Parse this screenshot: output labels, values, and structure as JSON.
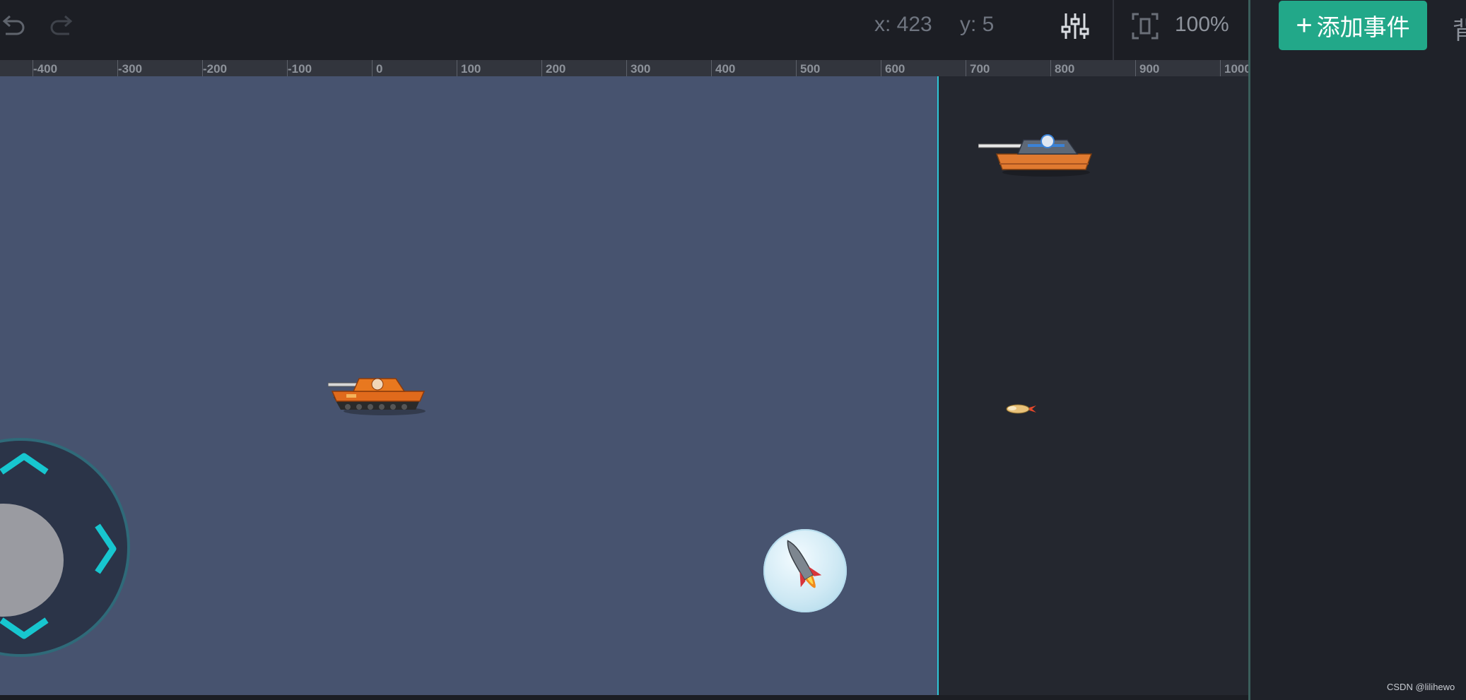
{
  "toolbar": {
    "undo_icon": "undo-icon",
    "redo_icon": "redo-icon",
    "x_label": "x: 423",
    "y_label": "y: 5",
    "settings_icon": "sliders-icon",
    "fit_icon": "fit-screen-icon",
    "zoom": "100%"
  },
  "right_panel": {
    "add_event_plus": "+",
    "add_event_label": "添加事件",
    "cut_text": "背"
  },
  "ruler": {
    "ticks": [
      "-400",
      "-300",
      "-200",
      "-100",
      "0",
      "100",
      "200",
      "300",
      "400",
      "500",
      "600",
      "700",
      "800",
      "900",
      "1000"
    ]
  },
  "colors": {
    "accent": "#22a889",
    "stage": "#47536f",
    "stage_border": "#2ec6d6",
    "joystick_arrow": "#17c6cf"
  },
  "canvas": {
    "sprites": [
      "player-tank",
      "enemy-tank",
      "bullet",
      "missile-fire-button",
      "joystick"
    ]
  },
  "watermark": "CSDN @lilihewo"
}
